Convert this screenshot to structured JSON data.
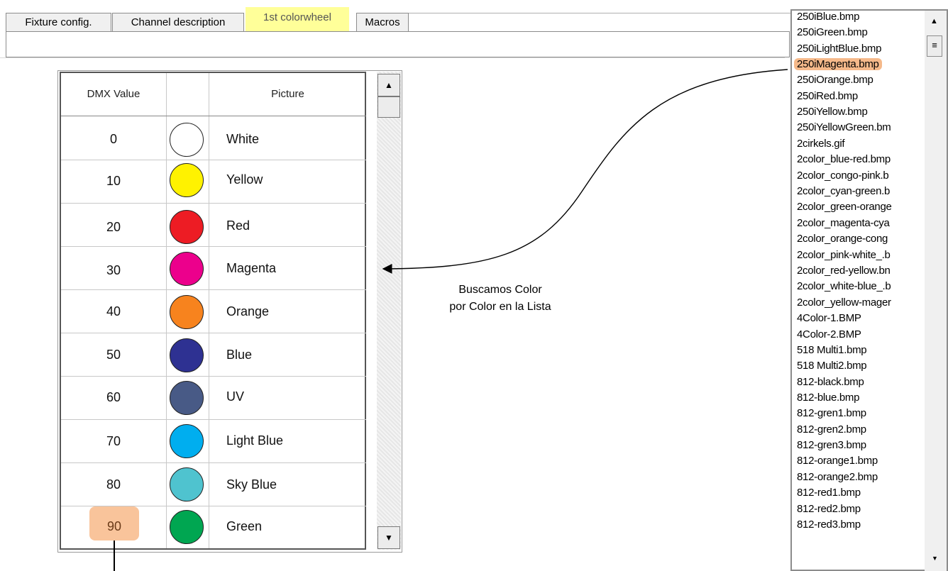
{
  "tabs": [
    {
      "label": "Fixture config."
    },
    {
      "label": "Channel description"
    },
    {
      "label": "1st colorwheel"
    },
    {
      "label": "Macros"
    }
  ],
  "grid": {
    "headers": {
      "dmx": "DMX Value",
      "picture": "Picture"
    },
    "rows": [
      {
        "value": "0",
        "name": "White",
        "color": "#ffffff"
      },
      {
        "value": "10",
        "name": "Yellow",
        "color": "#fff200"
      },
      {
        "value": "20",
        "name": "Red",
        "color": "#ed1c24"
      },
      {
        "value": "30",
        "name": "Magenta",
        "color": "#ec008c"
      },
      {
        "value": "40",
        "name": "Orange",
        "color": "#f7831e"
      },
      {
        "value": "50",
        "name": "Blue",
        "color": "#2e3192"
      },
      {
        "value": "60",
        "name": "UV",
        "color": "#485a86"
      },
      {
        "value": "70",
        "name": "Light Blue",
        "color": "#00aeef"
      },
      {
        "value": "80",
        "name": "Sky Blue",
        "color": "#4fc3cf"
      },
      {
        "value": "90",
        "name": "Green",
        "color": "#00a651"
      }
    ],
    "highlighted_value": "90"
  },
  "file_list": {
    "selected": "250iMagenta.bmp",
    "items": [
      "250iBlue.bmp",
      "250iGreen.bmp",
      "250iLightBlue.bmp",
      "250iMagenta.bmp",
      "250iOrange.bmp",
      "250iRed.bmp",
      "250iYellow.bmp",
      "250iYellowGreen.bm",
      "2cirkels.gif",
      "2color_blue-red.bmp",
      "2color_congo-pink.b",
      "2color_cyan-green.b",
      "2color_green-orange",
      "2color_magenta-cya",
      "2color_orange-cong",
      "2color_pink-white_.b",
      "2color_red-yellow.bn",
      "2color_white-blue_.b",
      "2color_yellow-mager",
      "4Color-1.BMP",
      "4Color-2.BMP",
      "518 Multi1.bmp",
      "518 Multi2.bmp",
      "812-black.bmp",
      "812-blue.bmp",
      "812-gren1.bmp",
      "812-gren2.bmp",
      "812-gren3.bmp",
      "812-orange1.bmp",
      "812-orange2.bmp",
      "812-red1.bmp",
      "812-red2.bmp",
      "812-red3.bmp"
    ]
  },
  "annotation": {
    "line1": "Buscamos Color",
    "line2": "por Color en la Lista"
  },
  "colors": {
    "tab_highlight": "#ffff99",
    "selection_highlight": "#f5b98a",
    "value_highlight": "#f9c49b"
  }
}
